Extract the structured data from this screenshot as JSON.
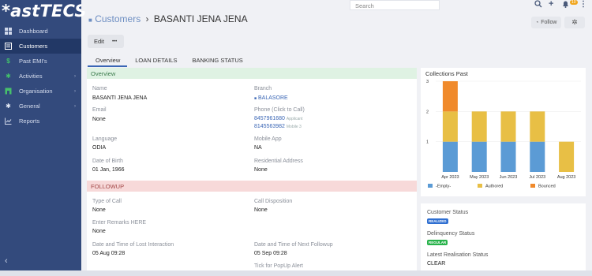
{
  "app": {
    "logo": "*astTECS"
  },
  "nav": {
    "items": [
      {
        "label": "Dashboard",
        "icon": "grid-icon"
      },
      {
        "label": "Customers",
        "icon": "list-icon",
        "active": true
      },
      {
        "label": "Past EMI's",
        "icon": "dollar-icon"
      },
      {
        "label": "Activities",
        "icon": "run-icon",
        "has_children": true
      },
      {
        "label": "Organisation",
        "icon": "building-icon",
        "has_children": true
      },
      {
        "label": "General",
        "icon": "star-icon",
        "has_children": true
      },
      {
        "label": "Reports",
        "icon": "chart-icon"
      }
    ]
  },
  "topbar": {
    "search_placeholder": "Search",
    "notif_count": "10"
  },
  "header": {
    "breadcrumb": "Customers",
    "separator": "›",
    "title": "BASANTI JENA JENA",
    "follow_label": "Follow",
    "edit_label": "Edit",
    "more_label": "•••"
  },
  "tabs": [
    "Overview",
    "LOAN DETAILS",
    "BANKING STATUS"
  ],
  "overview": {
    "section_title": "Overview",
    "name_label": "Name",
    "name_value": "BASANTI JENA JENA",
    "branch_label": "Branch",
    "branch_value": "BALASORE",
    "email_label": "Email",
    "email_value": "None",
    "phone_label": "Phone (Click to Call)",
    "phone1": "8457961680",
    "phone1_tag": "Applicant",
    "phone2": "8145563982",
    "phone2_tag": "Mobile 3",
    "language_label": "Language",
    "language_value": "ODIA",
    "mobileapp_label": "Mobile App",
    "mobileapp_value": "NA",
    "dob_label": "Date of Birth",
    "dob_value": "01 Jan, 1966",
    "address_label": "Residential Address",
    "address_value": "None"
  },
  "followup": {
    "section_title": "FOLLOWUP",
    "typecall_label": "Type of Call",
    "typecall_value": "None",
    "disposition_label": "Call Disposition",
    "disposition_value": "None",
    "remarks_label": "Enter Remarks HERE",
    "remarks_value": "None",
    "lost_label": "Date and Time of Lost Interaction",
    "lost_value": "05 Aug 09:28",
    "next_label": "Date and Time of Next Followup",
    "next_value": "05 Sep 09:28",
    "popup_label": "Tick for PopUp Alert"
  },
  "chart_card": {
    "title": "Collections Past"
  },
  "chart_data": {
    "type": "bar",
    "stacked": true,
    "categories": [
      "Apr 2023",
      "May 2023",
      "Jun 2023",
      "Jul 2023",
      "Aug 2023"
    ],
    "series": [
      {
        "name": "-Empty-",
        "values": [
          1,
          1,
          1,
          1,
          0
        ],
        "color": "#5b9bd5"
      },
      {
        "name": "Authored",
        "values": [
          1,
          1,
          1,
          1,
          1
        ],
        "color": "#e8bf45"
      },
      {
        "name": "Bounced",
        "values": [
          1,
          0,
          0,
          0,
          0
        ],
        "color": "#f08a2b"
      }
    ],
    "yticks": [
      "1",
      "2",
      "3"
    ],
    "ylim": [
      0,
      3
    ]
  },
  "status": {
    "customer_label": "Customer Status",
    "customer_badge": "REALIZED",
    "customer_color": "#2f6fd1",
    "delinquency_label": "Delinquency Status",
    "delinquency_badge": "REGULAR",
    "delinquency_color": "#27b24a",
    "realisation_label": "Latest Realisation Status",
    "realisation_value": "CLEAR"
  }
}
